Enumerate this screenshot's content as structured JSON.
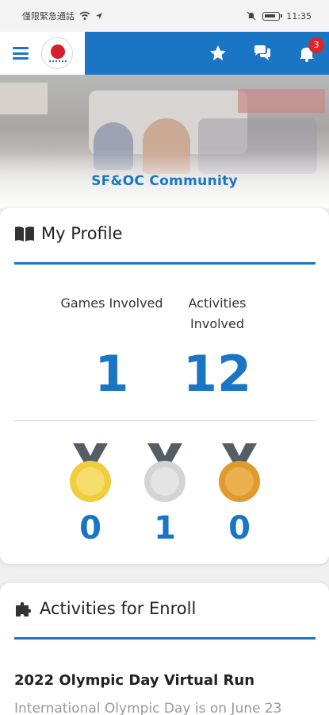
{
  "status_bar": {
    "carrier_text": "僅限緊急通話",
    "time": "11:35"
  },
  "header": {
    "notification_count": "3",
    "icons": [
      "menu-icon",
      "star-icon",
      "chat-icon",
      "bell-icon"
    ]
  },
  "banner": {
    "title": "SF&OC Community"
  },
  "profile": {
    "title": "My Profile",
    "games_label": "Games Involved",
    "games_value": "1",
    "activities_label": "Activities Involved",
    "activities_value": "12",
    "medals": [
      {
        "type": "gold",
        "count": "0"
      },
      {
        "type": "silver",
        "count": "1"
      },
      {
        "type": "bronze",
        "count": "0"
      }
    ]
  },
  "activities": {
    "title": "Activities for Enroll",
    "items": [
      {
        "title": "2022 Olympic Day Virtual Run",
        "description": "International Olympic Day is on June 23"
      }
    ]
  },
  "colors": {
    "accent": "#1a76c4",
    "badge": "#d9262c",
    "gold": "#f0cd3c",
    "silver": "#d4d4d4",
    "bronze": "#e09a2e"
  }
}
